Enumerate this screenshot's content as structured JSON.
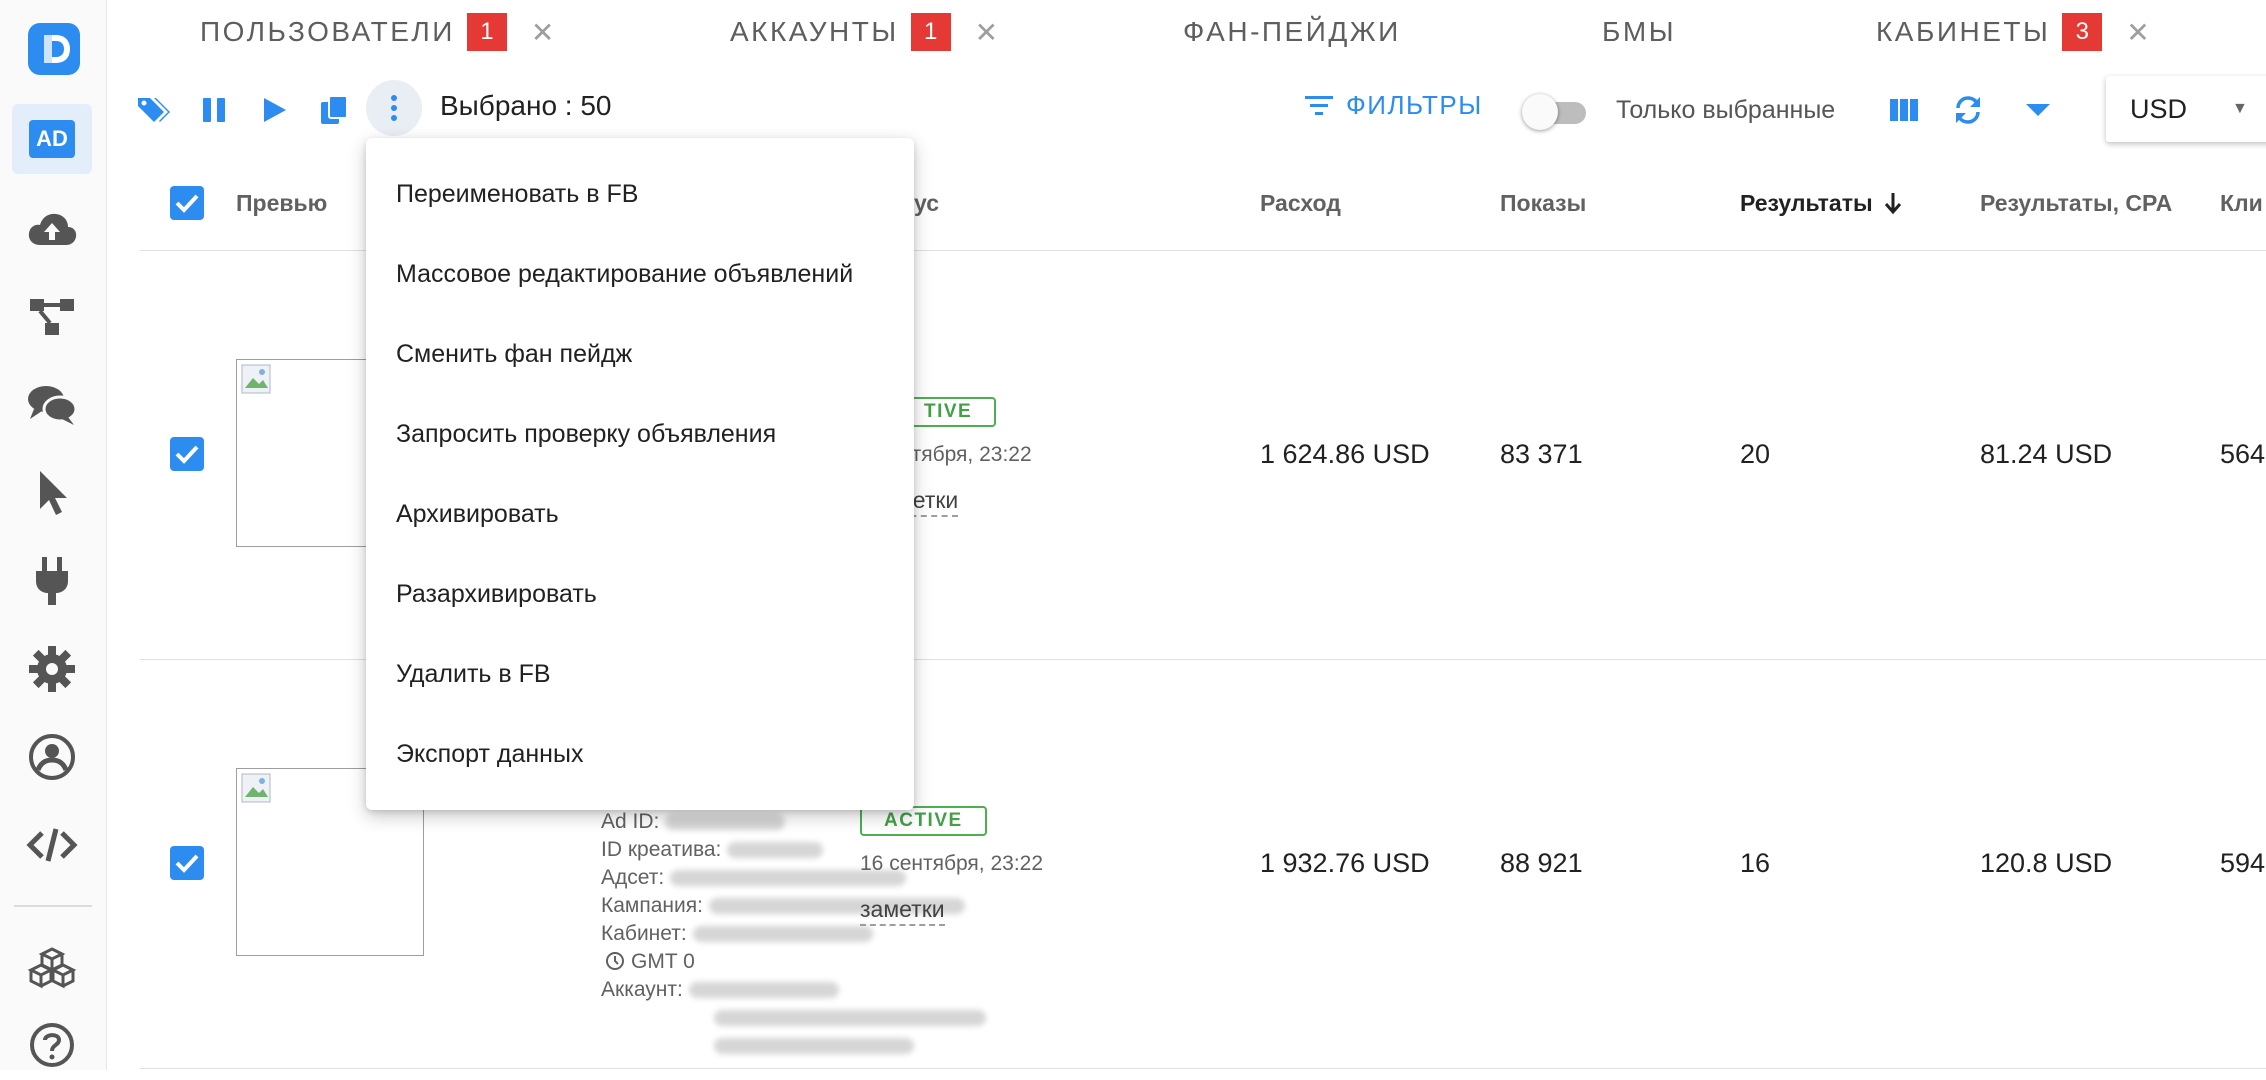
{
  "tabs": [
    {
      "label": "ПОЛЬЗОВАТЕЛИ",
      "badge": "1",
      "closable": true
    },
    {
      "label": "АККАУНТЫ",
      "badge": "1",
      "closable": true
    },
    {
      "label": "ФАН-ПЕЙДЖИ"
    },
    {
      "label": "БМЫ"
    },
    {
      "label": "КАБИНЕТЫ",
      "badge": "3",
      "closable": true
    }
  ],
  "sidebar": {
    "logo_letter": "D",
    "active_label": "AD",
    "icons": [
      "cloud-upload-icon",
      "hierarchy-icon",
      "chat-icon",
      "cursor-icon",
      "plug-icon",
      "gear-icon",
      "account-icon",
      "code-icon",
      "cubes-icon",
      "help-icon"
    ]
  },
  "toolbar": {
    "selected_label": "Выбрано : 50",
    "filters_label": "ФИЛЬТРЫ",
    "only_selected_label": "Только выбранные",
    "only_selected_on": false,
    "currency": "USD"
  },
  "table": {
    "headers": {
      "preview": "Превью",
      "status": "ус",
      "spend": "Расход",
      "impressions": "Показы",
      "results": "Результаты",
      "results_cpa": "Результаты, CPA",
      "clicks": "Кли"
    },
    "rows": [
      {
        "status": "TIVE",
        "date": "нтября, 23:22",
        "notes": "ает​ки",
        "spend": "1 624.86 USD",
        "impressions": "83 371",
        "results": "20",
        "cpa": "81.24 USD",
        "clicks": "564"
      },
      {
        "status": "ACTIVE",
        "date": "16 сентября, 23:22",
        "notes": "заметки",
        "spend": "1 932.76 USD",
        "impressions": "88 921",
        "results": "16",
        "cpa": "120.8 USD",
        "clicks": "594",
        "meta": {
          "ad_id": "Ad ID:",
          "creative_id": "ID креатива:",
          "adset": "Адсет:",
          "campaign": "Кампания:",
          "cabinet": "Кабинет:",
          "timezone": "GMT 0",
          "account": "Аккаунт:"
        }
      }
    ]
  },
  "menu": {
    "items": [
      "Переименовать в FB",
      "Массовое редактирование объявлений",
      "Сменить фан пейдж",
      "Запросить проверку объявления",
      "Архивировать",
      "Разархивировать",
      "Удалить в FB",
      "Экспорт данных"
    ]
  },
  "colors": {
    "accent": "#2d8cf0",
    "badge": "#e53935",
    "active": "#4caf50"
  }
}
